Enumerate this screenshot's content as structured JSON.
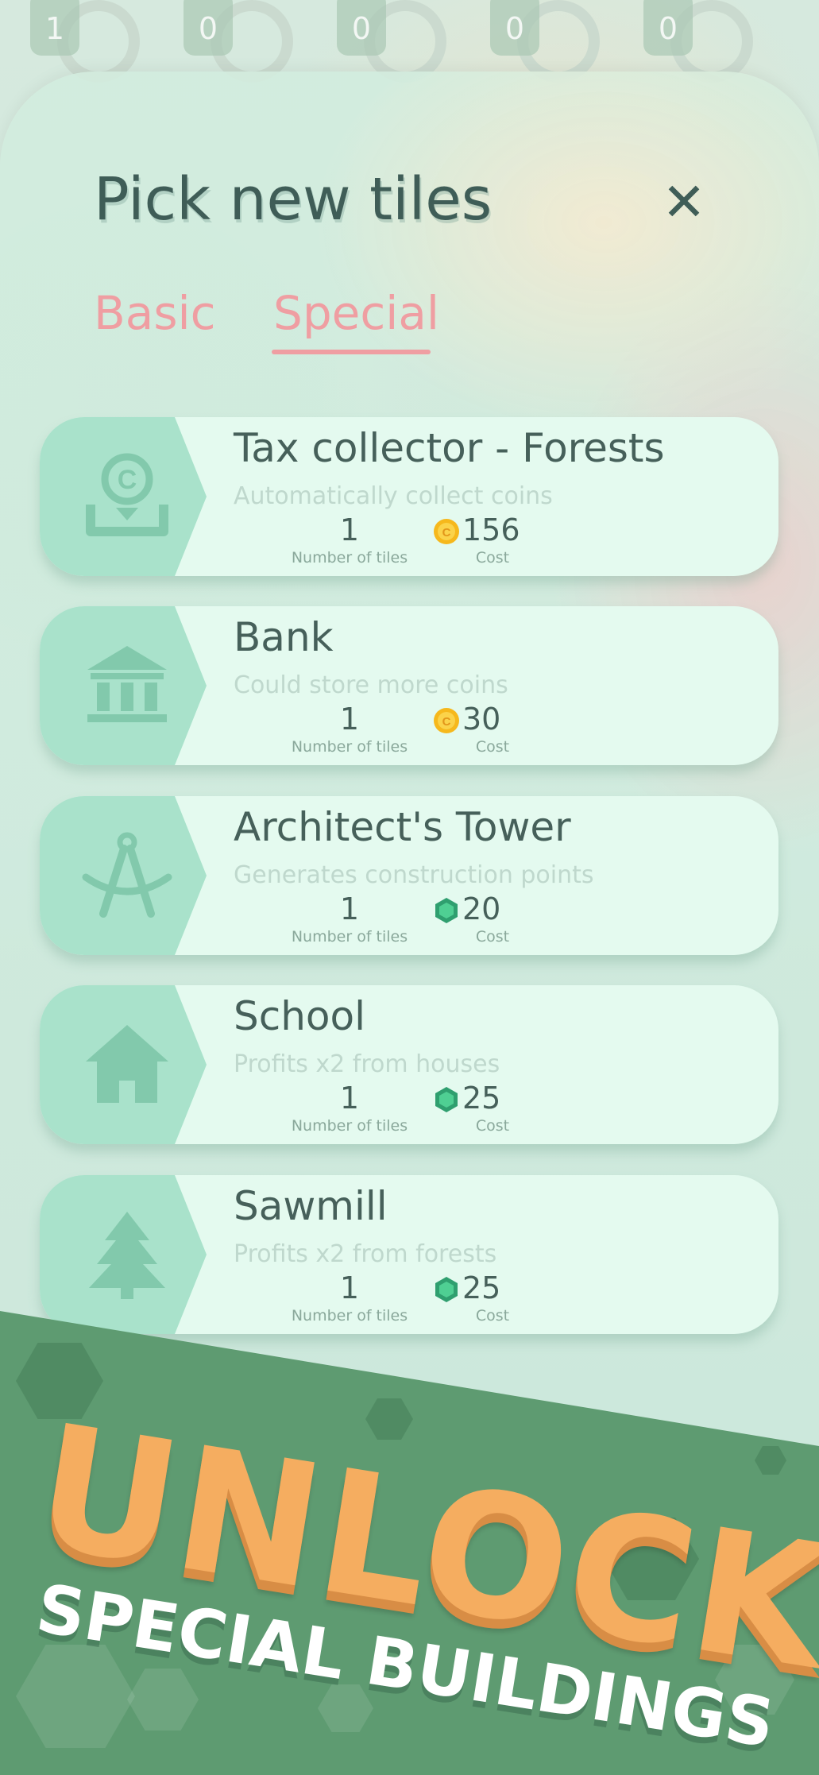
{
  "counters": [
    "1",
    "0",
    "0",
    "0",
    "0"
  ],
  "modal": {
    "title": "Pick new tiles",
    "close_label": "✕",
    "tabs": [
      {
        "label": "Basic",
        "active": false
      },
      {
        "label": "Special",
        "active": true
      }
    ]
  },
  "cards": [
    {
      "name": "Tax collector - Forests",
      "description": "Automatically collect coins",
      "tiles": "1",
      "tiles_label": "Number of tiles",
      "cost": "156",
      "cost_label": "Cost",
      "currency": "coin",
      "icon": "tax-collector-icon"
    },
    {
      "name": "Bank",
      "description": "Could store more coins",
      "tiles": "1",
      "tiles_label": "Number of tiles",
      "cost": "30",
      "cost_label": "Cost",
      "currency": "coin",
      "icon": "bank-icon"
    },
    {
      "name": "Architect's Tower",
      "description": "Generates construction points",
      "tiles": "1",
      "tiles_label": "Number of tiles",
      "cost": "20",
      "cost_label": "Cost",
      "currency": "gem",
      "icon": "compass-icon"
    },
    {
      "name": "School",
      "description": "Profits x2 from houses",
      "tiles": "1",
      "tiles_label": "Number of tiles",
      "cost": "25",
      "cost_label": "Cost",
      "currency": "gem",
      "icon": "house-icon"
    },
    {
      "name": "Sawmill",
      "description": "Profits x2 from forests",
      "tiles": "1",
      "tiles_label": "Number of tiles",
      "cost": "25",
      "cost_label": "Cost",
      "currency": "gem",
      "icon": "tree-icon"
    }
  ],
  "promo": {
    "headline": "UNLOCK",
    "subline": "SPECIAL BUILDINGS"
  },
  "colors": {
    "accent_pink": "#ef9ea2",
    "card_bg": "#e4faef",
    "text_dark": "#46605a",
    "promo_orange": "#f5ad60",
    "banner_green": "#5e9b71"
  }
}
